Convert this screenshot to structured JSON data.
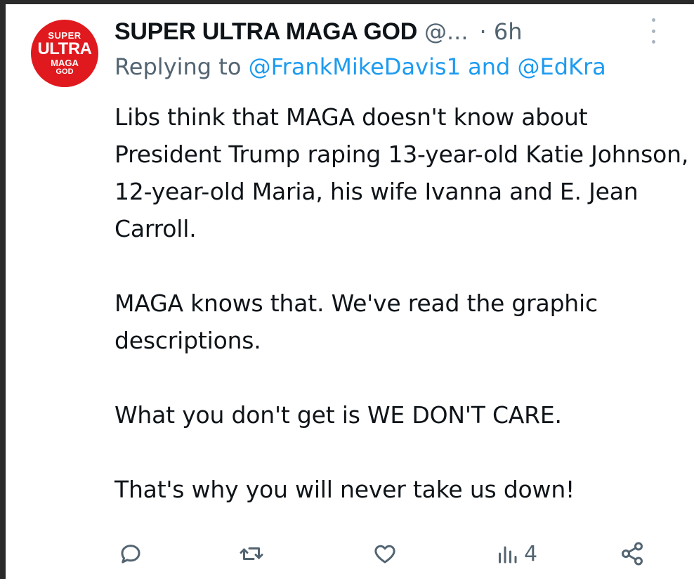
{
  "tweet": {
    "avatar_text": [
      "SUPER",
      "ULTRA",
      "MAGA",
      "GOD"
    ],
    "display_name": "SUPER ULTRA MAGA GOD",
    "handle": "@...",
    "time": "· 6h",
    "reply_prefix": "Replying to",
    "reply_user1": "@FrankMikeDavis1",
    "reply_and": "and",
    "reply_user2": "@EdKra",
    "paragraphs": [
      "Libs think that MAGA doesn't know about President Trump raping 13-year-old Katie Johnson, 12-year-old Maria, his wife Ivanna and E. Jean Carroll.",
      "MAGA knows that. We've read the graphic descriptions.",
      "What you don't get is WE DON'T CARE.",
      "That's why you will never take us down!"
    ],
    "views_count": "4"
  },
  "icons": {
    "reply": "reply-icon",
    "retweet": "retweet-icon",
    "like": "heart-icon",
    "views": "views-icon",
    "share": "share-icon",
    "more": "more-options-icon"
  },
  "colors": {
    "avatar_bg": "#e0191e",
    "link": "#1d9bf0",
    "muted": "#536471",
    "text": "#0f1419"
  }
}
